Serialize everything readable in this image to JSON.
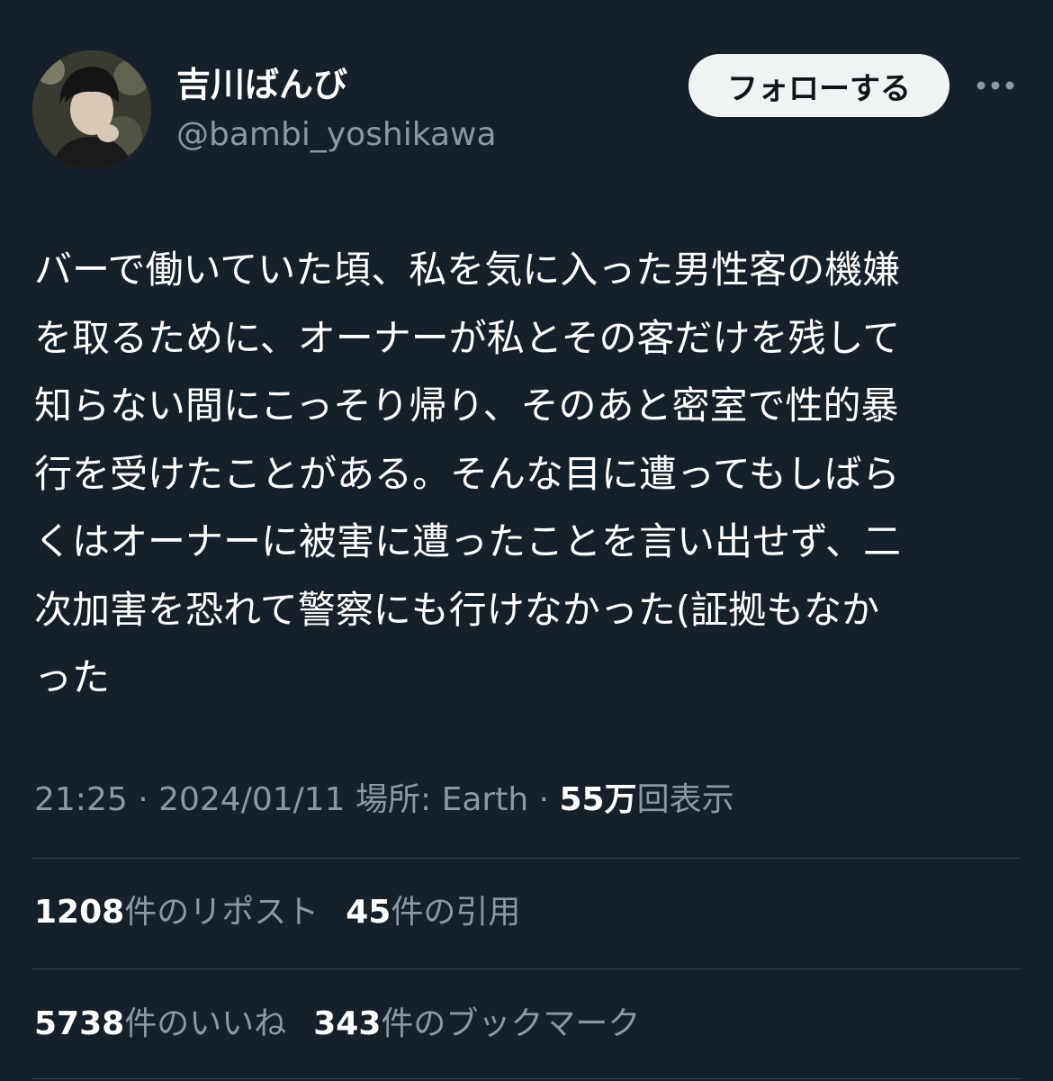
{
  "user": {
    "display_name": "吉川ばんび",
    "handle": "@bambi_yoshikawa",
    "avatar_icon": "profile-photo"
  },
  "follow_button_label": "フォローする",
  "more_icon": "more-horizontal-icon",
  "tweet_lines": [
    "バーで働いていた頃、私を気に入った男性客の機嫌",
    "を取るために、オーナーが私とその客だけを残して",
    "知らない間にこっそり帰り、そのあと密室で性的暴",
    "行を受けたことがある。そんな目に遭ってもしばら",
    "くはオーナーに被害に遭ったことを言い出せず、二",
    "次加害を恐れて警察にも行けなかった(証拠もなか",
    "った"
  ],
  "meta": {
    "time": "21:25",
    "sep1": " · ",
    "date": "2024/01/11",
    "location": " 場所: Earth",
    "sep2": " · ",
    "views_count": "55万",
    "views_label": "回表示"
  },
  "stats": {
    "reposts": {
      "count": "1208",
      "label": "件のリポスト"
    },
    "quotes": {
      "count": "45",
      "label": "件の引用"
    },
    "likes": {
      "count": "5738",
      "label": "件のいいね"
    },
    "bookmarks": {
      "count": "343",
      "label": "件のブックマーク"
    }
  },
  "colors": {
    "background": "#15202b",
    "primary_text": "#ffffff",
    "secondary_text": "#8b98a5",
    "divider": "#38444d",
    "button_bg": "#eff3f4",
    "button_text": "#0f1419"
  }
}
